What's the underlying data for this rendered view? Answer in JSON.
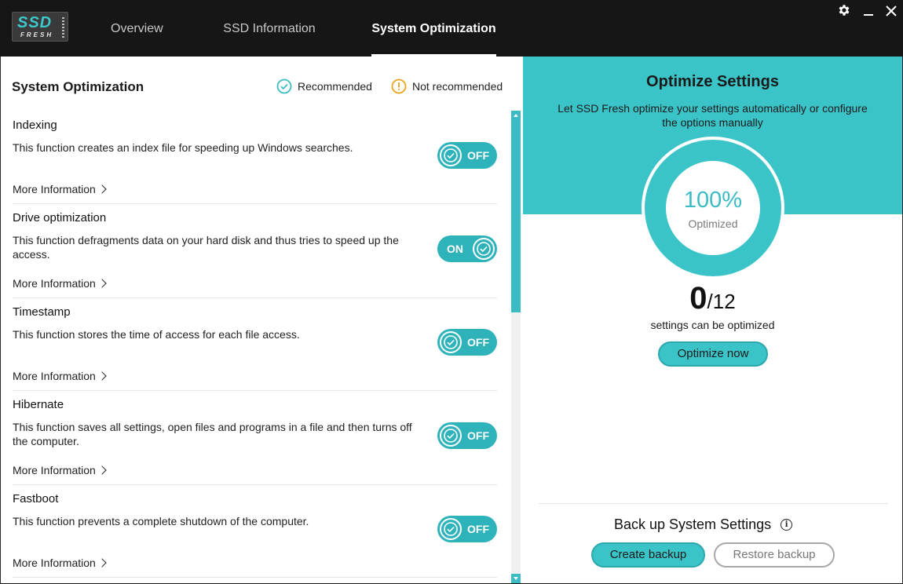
{
  "app": {
    "logo_text": "SSD",
    "logo_sub": "FRESH"
  },
  "tabs": [
    {
      "label": "Overview"
    },
    {
      "label": "SSD Information"
    },
    {
      "label": "System Optimization"
    }
  ],
  "left": {
    "title": "System Optimization",
    "legend_recommended": "Recommended",
    "legend_not_recommended": "Not recommended",
    "items": [
      {
        "name": "Indexing",
        "desc": "This function creates an index file for speeding up Windows searches.",
        "state": "OFF",
        "more": "More Information"
      },
      {
        "name": "Drive optimization",
        "desc": "This function defragments data on your hard disk and thus tries to speed up the access.",
        "state": "ON",
        "more": "More Information"
      },
      {
        "name": "Timestamp",
        "desc": "This function stores the time of access for each file access.",
        "state": "OFF",
        "more": "More Information"
      },
      {
        "name": "Hibernate",
        "desc": "This function saves all settings, open files and programs in a file and then turns off the computer.",
        "state": "OFF",
        "more": "More Information"
      },
      {
        "name": "Fastboot",
        "desc": "This function prevents a complete shutdown of the computer.",
        "state": "OFF",
        "more": "More Information"
      }
    ]
  },
  "right": {
    "title": "Optimize Settings",
    "subtitle": "Let SSD Fresh optimize your settings automatically or configure the options manually",
    "percent": "100%",
    "percent_label": "Optimized",
    "count_current": "0",
    "count_total": "/12",
    "count_label": "settings can be optimized",
    "optimize_button": "Optimize now",
    "backup_title": "Back up System Settings",
    "backup_button": "Create backup",
    "restore_button": "Restore backup"
  },
  "colors": {
    "accent": "#3bc4c8",
    "toggle": "#2fb3bb",
    "warning": "#e8a317",
    "titlebar": "#161616"
  },
  "icons": {
    "settings": "gear-icon",
    "minimize": "minimize-icon",
    "close": "close-icon",
    "recommended": "check-circle-icon",
    "not_recommended": "warning-circle-icon",
    "info": "info-icon"
  }
}
